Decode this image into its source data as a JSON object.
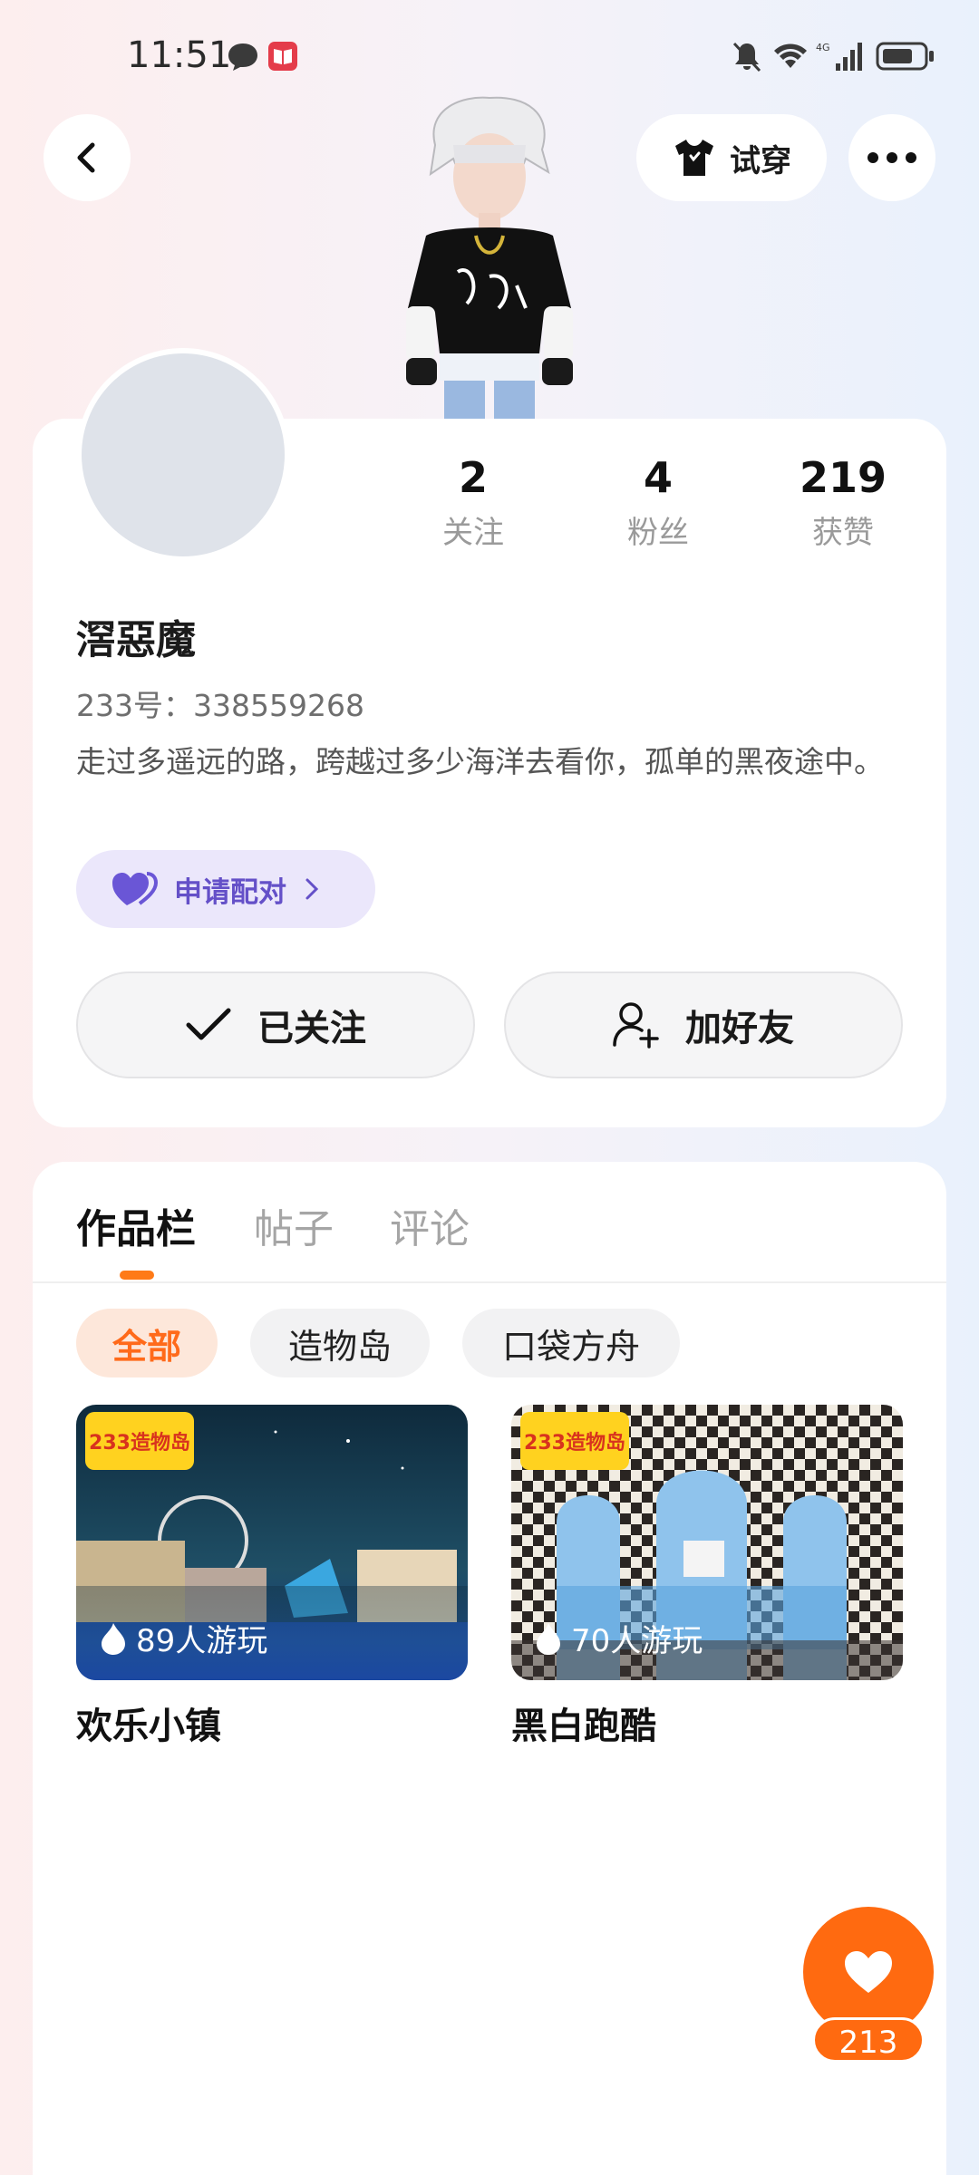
{
  "status_bar": {
    "time": "11:51"
  },
  "header": {
    "try_on_label": "试穿"
  },
  "profile": {
    "stats": [
      {
        "value": "2",
        "label": "关注"
      },
      {
        "value": "4",
        "label": "粉丝"
      },
      {
        "value": "219",
        "label": "获赞"
      }
    ],
    "username": "滘惡魔",
    "uid": "233号：338559268",
    "bio": "走过多遥远的路，跨越过多少海洋去看你，孤单的黑夜途中。",
    "pair_label": "申请配对",
    "follow_label": "已关注",
    "add_friend_label": "加好友"
  },
  "tabs": [
    {
      "label": "作品栏"
    },
    {
      "label": "帖子"
    },
    {
      "label": "评论"
    }
  ],
  "filters": [
    {
      "label": "全部"
    },
    {
      "label": "造物岛"
    },
    {
      "label": "口袋方舟"
    }
  ],
  "games": [
    {
      "badge": "233造物岛",
      "plays": "89人游玩",
      "title": "欢乐小镇"
    },
    {
      "badge": "233造物岛",
      "plays": "70人游玩",
      "title": "黑白跑酷"
    }
  ],
  "like": {
    "count": "213"
  },
  "colors": {
    "accent": "#ff6a10",
    "pair_purple": "#6450c8"
  }
}
